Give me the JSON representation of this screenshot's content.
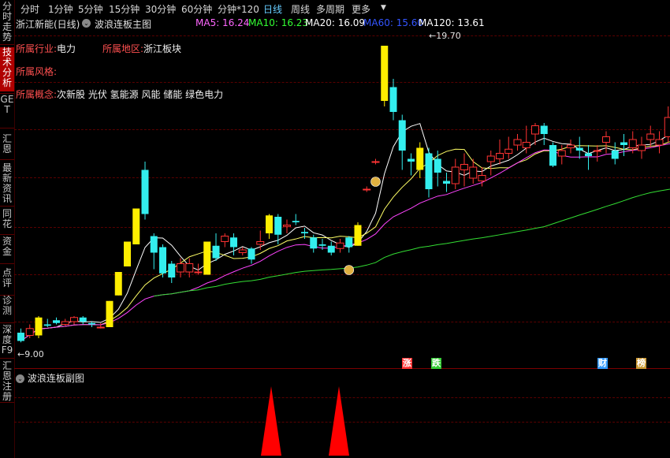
{
  "sidebar": {
    "items": [
      {
        "label": "分时走势"
      },
      {
        "label": "技术分析",
        "active": true
      },
      {
        "label": "GET"
      },
      {
        "label": "汇恩"
      },
      {
        "label": "最新资讯"
      },
      {
        "label": "同花"
      },
      {
        "label": "资金"
      },
      {
        "label": "点评"
      },
      {
        "label": "诊测"
      },
      {
        "label": "深度F9"
      },
      {
        "label": "汇恩注册"
      }
    ]
  },
  "toolbar": {
    "tabs": [
      {
        "label": "分时"
      },
      {
        "label": "1分钟"
      },
      {
        "label": "5分钟"
      },
      {
        "label": "15分钟"
      },
      {
        "label": "30分钟"
      },
      {
        "label": "60分钟"
      },
      {
        "label": "分钟*120"
      },
      {
        "label": "日线",
        "active": true
      },
      {
        "label": "周线"
      },
      {
        "label": "多周期"
      },
      {
        "label": "更多"
      }
    ]
  },
  "main": {
    "stock_title": "浙江新能(日线)",
    "indicator_title": "波浪连板主图",
    "ma": [
      {
        "label": "MA5: 16.24",
        "color": "#ff66ff"
      },
      {
        "label": "MA10: 16.23",
        "color": "#33ff33"
      },
      {
        "label": "MA20: 16.09",
        "color": "#ffffff"
      },
      {
        "label": "MA60: 15.60",
        "color": "#3355ff"
      },
      {
        "label": "MA120: 13.61",
        "color": "#ffffff"
      }
    ],
    "industry_label": "所属行业:",
    "industry_value": "电力",
    "region_label": "所属地区:",
    "region_value": "浙江板块",
    "style_label": "所属风格:",
    "concept_label": "所属概念:",
    "concept_value": "次新股 光伏 氢能源 风能 储能 绿色电力",
    "high_label": "19.70",
    "low_label": "9.00",
    "markers": [
      {
        "label": "涨",
        "color": "#ff3333"
      },
      {
        "label": "跌",
        "color": "#33cc33"
      },
      {
        "label": "财",
        "color": "#3399ff"
      },
      {
        "label": "榜",
        "color": "#cc9933"
      }
    ]
  },
  "sub": {
    "title": "波浪连板副图"
  },
  "chart_data": {
    "type": "candlestick",
    "candles": [
      {
        "o": 9.3,
        "c": 9.0,
        "h": 9.45,
        "l": 8.95
      },
      {
        "o": 9.2,
        "c": 9.45,
        "h": 9.6,
        "l": 9.1
      },
      {
        "o": 9.2,
        "c": 9.85,
        "h": 9.9,
        "l": 9.1
      },
      {
        "o": 9.6,
        "c": 9.55,
        "h": 9.8,
        "l": 9.5
      },
      {
        "o": 9.75,
        "c": 9.65,
        "h": 9.85,
        "l": 9.6
      },
      {
        "o": 9.6,
        "c": 9.7,
        "h": 9.8,
        "l": 9.55
      },
      {
        "o": 9.7,
        "c": 9.85,
        "h": 9.9,
        "l": 9.6
      },
      {
        "o": 9.85,
        "c": 9.7,
        "h": 9.9,
        "l": 9.6
      },
      {
        "o": 9.65,
        "c": 9.6,
        "h": 9.7,
        "l": 9.5
      },
      {
        "o": 9.5,
        "c": 9.5,
        "h": 9.65,
        "l": 9.45
      },
      {
        "o": 9.5,
        "c": 10.45,
        "h": 10.45,
        "l": 9.5
      },
      {
        "o": 10.65,
        "c": 11.5,
        "h": 11.5,
        "l": 10.65
      },
      {
        "o": 11.7,
        "c": 12.6,
        "h": 12.6,
        "l": 11.7
      },
      {
        "o": 12.5,
        "c": 13.8,
        "h": 13.8,
        "l": 12.5
      },
      {
        "o": 15.2,
        "c": 13.6,
        "h": 15.5,
        "l": 13.4
      },
      {
        "o": 12.8,
        "c": 12.2,
        "h": 12.9,
        "l": 11.6
      },
      {
        "o": 12.4,
        "c": 11.45,
        "h": 12.5,
        "l": 11.3
      },
      {
        "o": 11.8,
        "c": 11.3,
        "h": 11.9,
        "l": 11.1
      },
      {
        "o": 11.5,
        "c": 11.8,
        "h": 12.0,
        "l": 11.3
      },
      {
        "o": 11.5,
        "c": 11.8,
        "h": 12.0,
        "l": 11.3
      },
      {
        "o": 11.5,
        "c": 11.5,
        "h": 11.8,
        "l": 11.4
      },
      {
        "o": 11.4,
        "c": 12.6,
        "h": 12.6,
        "l": 11.4
      },
      {
        "o": 12.45,
        "c": 12.0,
        "h": 12.9,
        "l": 11.9
      },
      {
        "o": 12.6,
        "c": 12.8,
        "h": 12.9,
        "l": 12.4
      },
      {
        "o": 12.75,
        "c": 12.4,
        "h": 12.9,
        "l": 12.1
      },
      {
        "o": 12.2,
        "c": 12.3,
        "h": 12.4,
        "l": 12.1
      },
      {
        "o": 12.35,
        "c": 11.95,
        "h": 12.4,
        "l": 11.8
      },
      {
        "o": 12.5,
        "c": 12.6,
        "h": 13.0,
        "l": 12.3
      },
      {
        "o": 12.9,
        "c": 13.55,
        "h": 13.6,
        "l": 12.7
      },
      {
        "o": 13.5,
        "c": 12.85,
        "h": 13.6,
        "l": 12.5
      },
      {
        "o": 13.15,
        "c": 13.2,
        "h": 13.4,
        "l": 12.9
      },
      {
        "o": 13.35,
        "c": 13.3,
        "h": 13.6,
        "l": 13.2
      },
      {
        "o": 12.95,
        "c": 12.9,
        "h": 13.1,
        "l": 12.7
      },
      {
        "o": 12.75,
        "c": 12.35,
        "h": 12.85,
        "l": 12.2
      },
      {
        "o": 12.5,
        "c": 12.45,
        "h": 12.7,
        "l": 12.3
      },
      {
        "o": 12.45,
        "c": 12.2,
        "h": 12.6,
        "l": 12.1
      },
      {
        "o": 12.35,
        "c": 12.55,
        "h": 12.7,
        "l": 12.2
      },
      {
        "o": 12.75,
        "c": 12.4,
        "h": 12.8,
        "l": 12.2
      },
      {
        "o": 12.45,
        "c": 13.2,
        "h": 13.3,
        "l": 12.45
      },
      {
        "o": 14.5,
        "c": 14.5,
        "h": 14.6,
        "l": 14.4
      },
      {
        "o": 15.5,
        "c": 15.5,
        "h": 15.6,
        "l": 15.4
      },
      {
        "o": 17.7,
        "c": 19.7,
        "h": 19.7,
        "l": 17.5
      },
      {
        "o": 18.2,
        "c": 17.3,
        "h": 18.5,
        "l": 17.0
      },
      {
        "o": 17.0,
        "c": 15.9,
        "h": 17.2,
        "l": 15.2
      },
      {
        "o": 15.6,
        "c": 15.5,
        "h": 15.8,
        "l": 15.0
      },
      {
        "o": 15.2,
        "c": 16.0,
        "h": 16.2,
        "l": 14.9
      },
      {
        "o": 15.8,
        "c": 14.5,
        "h": 16.0,
        "l": 14.2
      },
      {
        "o": 15.6,
        "c": 15.1,
        "h": 15.9,
        "l": 14.6
      },
      {
        "o": 14.8,
        "c": 14.7,
        "h": 15.1,
        "l": 14.4
      },
      {
        "o": 14.7,
        "c": 15.3,
        "h": 15.6,
        "l": 14.5
      },
      {
        "o": 15.2,
        "c": 15.4,
        "h": 15.8,
        "l": 14.6
      },
      {
        "o": 14.9,
        "c": 15.3,
        "h": 15.6,
        "l": 14.7
      },
      {
        "o": 14.8,
        "c": 15.0,
        "h": 15.3,
        "l": 14.6
      },
      {
        "o": 15.5,
        "c": 15.7,
        "h": 15.9,
        "l": 15.0
      },
      {
        "o": 15.6,
        "c": 15.8,
        "h": 16.3,
        "l": 15.4
      },
      {
        "o": 15.8,
        "c": 15.95,
        "h": 16.4,
        "l": 15.6
      },
      {
        "o": 16.1,
        "c": 16.3,
        "h": 16.5,
        "l": 15.9
      },
      {
        "o": 16.0,
        "c": 16.2,
        "h": 16.8,
        "l": 15.8
      },
      {
        "o": 16.5,
        "c": 16.8,
        "h": 16.9,
        "l": 16.1
      },
      {
        "o": 16.8,
        "c": 16.5,
        "h": 16.9,
        "l": 16.1
      },
      {
        "o": 16.1,
        "c": 15.35,
        "h": 16.2,
        "l": 15.3
      },
      {
        "o": 15.7,
        "c": 15.9,
        "h": 16.1,
        "l": 15.4
      },
      {
        "o": 16.0,
        "c": 16.1,
        "h": 16.3,
        "l": 15.8
      },
      {
        "o": 16.0,
        "c": 15.9,
        "h": 16.4,
        "l": 15.6
      },
      {
        "o": 15.8,
        "c": 15.7,
        "h": 16.1,
        "l": 15.2
      },
      {
        "o": 15.9,
        "c": 15.9,
        "h": 16.1,
        "l": 15.5
      },
      {
        "o": 16.2,
        "c": 16.4,
        "h": 16.6,
        "l": 15.8
      },
      {
        "o": 15.9,
        "c": 15.6,
        "h": 16.2,
        "l": 15.4
      },
      {
        "o": 16.2,
        "c": 16.1,
        "h": 16.5,
        "l": 15.7
      },
      {
        "o": 16.0,
        "c": 16.3,
        "h": 16.6,
        "l": 15.8
      },
      {
        "o": 15.9,
        "c": 16.1,
        "h": 16.4,
        "l": 15.6
      },
      {
        "o": 16.3,
        "c": 16.5,
        "h": 16.8,
        "l": 16.0
      },
      {
        "o": 16.1,
        "c": 16.3,
        "h": 16.6,
        "l": 15.8
      },
      {
        "o": 16.4,
        "c": 17.1,
        "h": 17.5,
        "l": 16.2
      },
      {
        "o": 16.3,
        "c": 16.6,
        "h": 16.8,
        "l": 16.0
      },
      {
        "o": 16.1,
        "c": 16.4,
        "h": 16.6,
        "l": 15.9
      }
    ],
    "ylim": [
      8.5,
      20.5
    ],
    "markers_days": [
      37,
      40
    ]
  }
}
